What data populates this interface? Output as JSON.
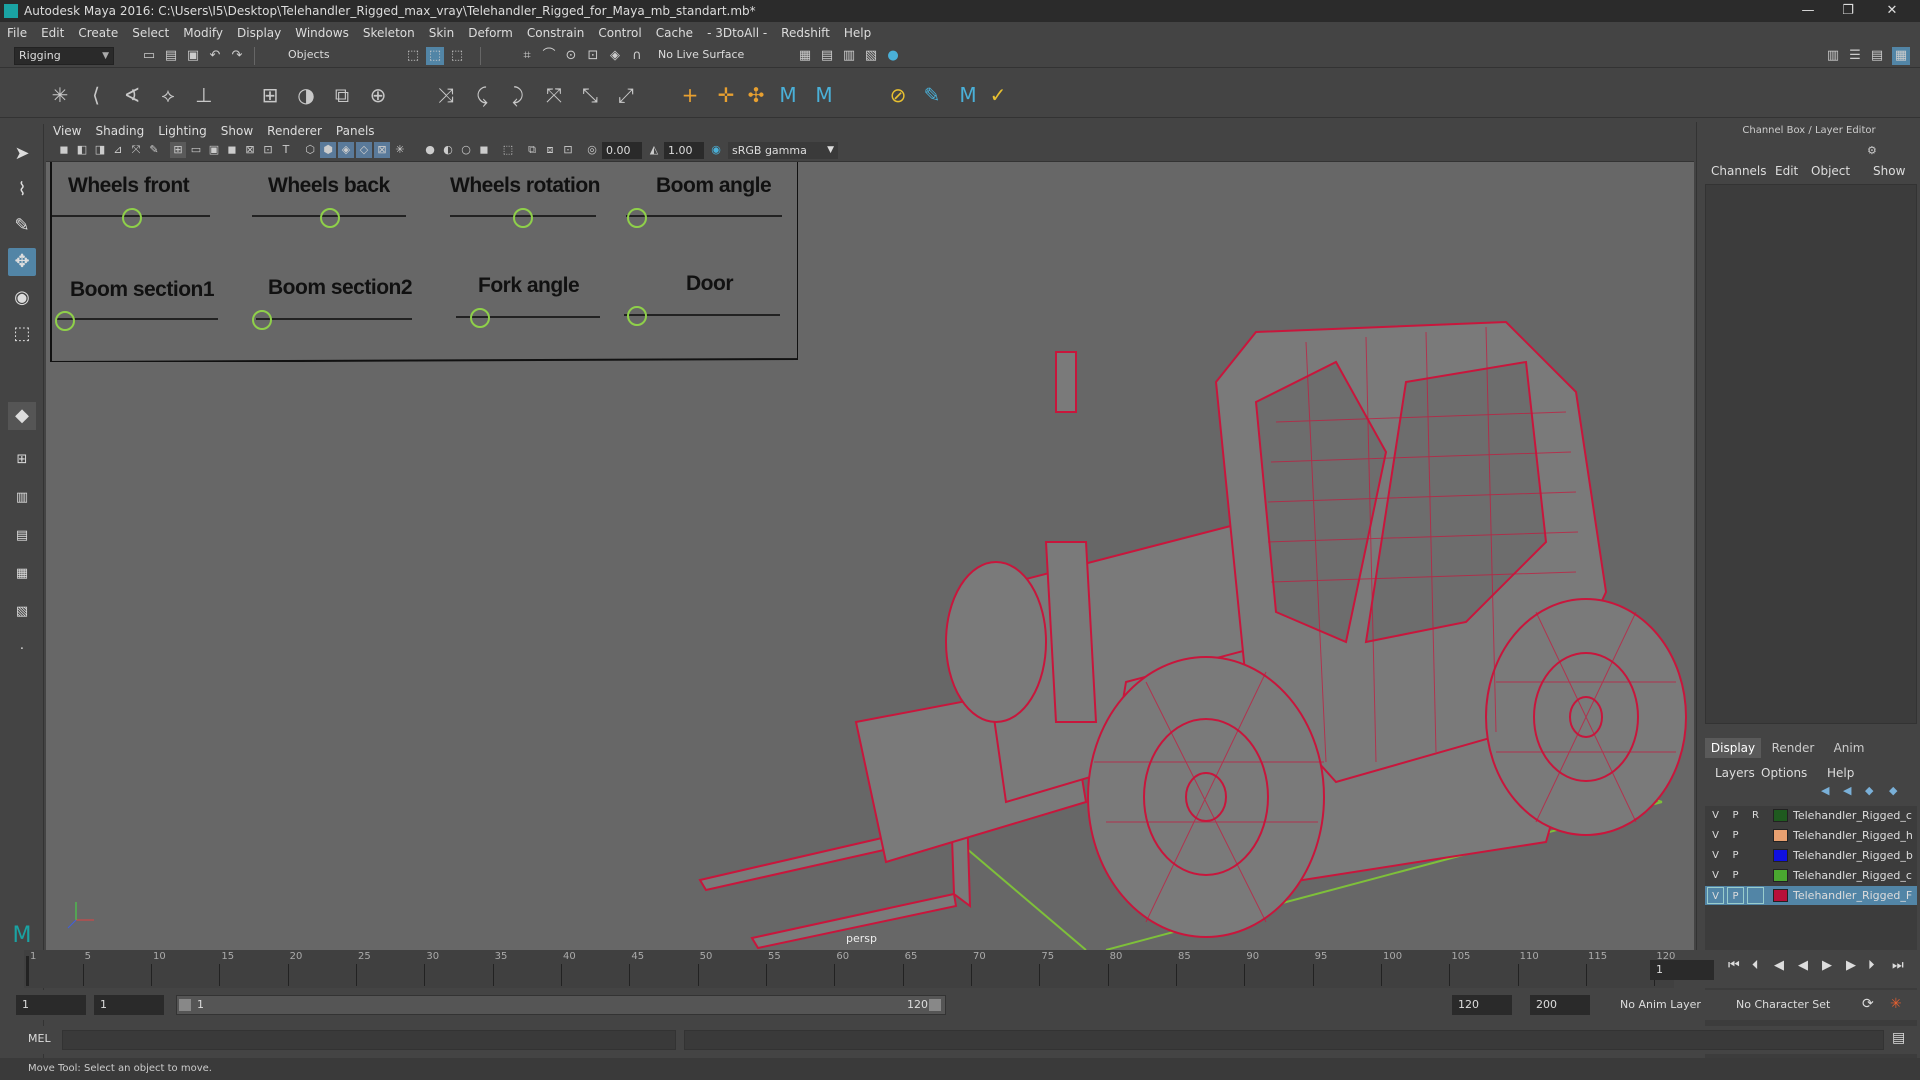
{
  "window": {
    "title": "Autodesk Maya 2016: C:\\Users\\I5\\Desktop\\Telehandler_Rigged_max_vray\\Telehandler_Rigged_for_Maya_mb_standart.mb*",
    "minimize": "—",
    "restore": "❐",
    "close": "✕"
  },
  "menus": [
    "File",
    "Edit",
    "Create",
    "Select",
    "Modify",
    "Display",
    "Windows",
    "Skeleton",
    "Skin",
    "Deform",
    "Constrain",
    "Control",
    "Cache",
    "- 3DtoAll -",
    "Redshift",
    "Help"
  ],
  "statusline": {
    "menuset": "Rigging",
    "selection_mode": "Objects",
    "live_surface": "No Live Surface"
  },
  "viewport": {
    "menus": [
      "View",
      "Shading",
      "Lighting",
      "Show",
      "Renderer",
      "Panels"
    ],
    "exposure": "0.00",
    "gamma": "1.00",
    "color_space": "sRGB gamma",
    "camera_label": "persp"
  },
  "controls": {
    "wheels_front": "Wheels front",
    "wheels_back": "Wheels back",
    "wheels_rotation": "Wheels rotation",
    "boom_angle": "Boom angle",
    "boom_section1": "Boom section1",
    "boom_section2": "Boom section2",
    "fork_angle": "Fork angle",
    "door": "Door"
  },
  "right_panel": {
    "header": "Channel Box / Layer Editor",
    "tabs": [
      "Channels",
      "Edit",
      "Object",
      "Show"
    ],
    "layer_tabs": [
      "Display",
      "Render",
      "Anim"
    ],
    "layer_menus": [
      "Layers",
      "Options",
      "Help"
    ],
    "layers": [
      {
        "v": "V",
        "p": "P",
        "r": "R",
        "name": "Telehandler_Rigged_c",
        "color": "#1f5a1f"
      },
      {
        "v": "V",
        "p": "P",
        "r": "",
        "name": "Telehandler_Rigged_h",
        "color": "#e8a070"
      },
      {
        "v": "V",
        "p": "P",
        "r": "",
        "name": "Telehandler_Rigged_b",
        "color": "#1010e0"
      },
      {
        "v": "V",
        "p": "P",
        "r": "",
        "name": "Telehandler_Rigged_c",
        "color": "#4aa830"
      },
      {
        "v": "V",
        "p": "P",
        "r": "",
        "name": "Telehandler_Rigged_F",
        "color": "#b8103a"
      }
    ]
  },
  "timeline": {
    "ticks": [
      "1",
      "5",
      "10",
      "15",
      "20",
      "25",
      "30",
      "35",
      "40",
      "45",
      "50",
      "55",
      "60",
      "65",
      "70",
      "75",
      "80",
      "85",
      "90",
      "95",
      "100",
      "105",
      "110",
      "115",
      "120"
    ],
    "current_frame": "1"
  },
  "range": {
    "start": "1",
    "playback_start": "1",
    "slider_start": "1",
    "slider_end": "120",
    "playback_end": "120",
    "end": "200",
    "anim_layer": "No Anim Layer",
    "character_set": "No Character Set"
  },
  "command": {
    "language": "MEL",
    "help": "Move Tool: Select an object to move."
  },
  "colors": {
    "wireframe": "#c8163c",
    "grid_line": "#7ec03a",
    "slider_ring": "#8fd04a",
    "selection": "#5285a6"
  }
}
